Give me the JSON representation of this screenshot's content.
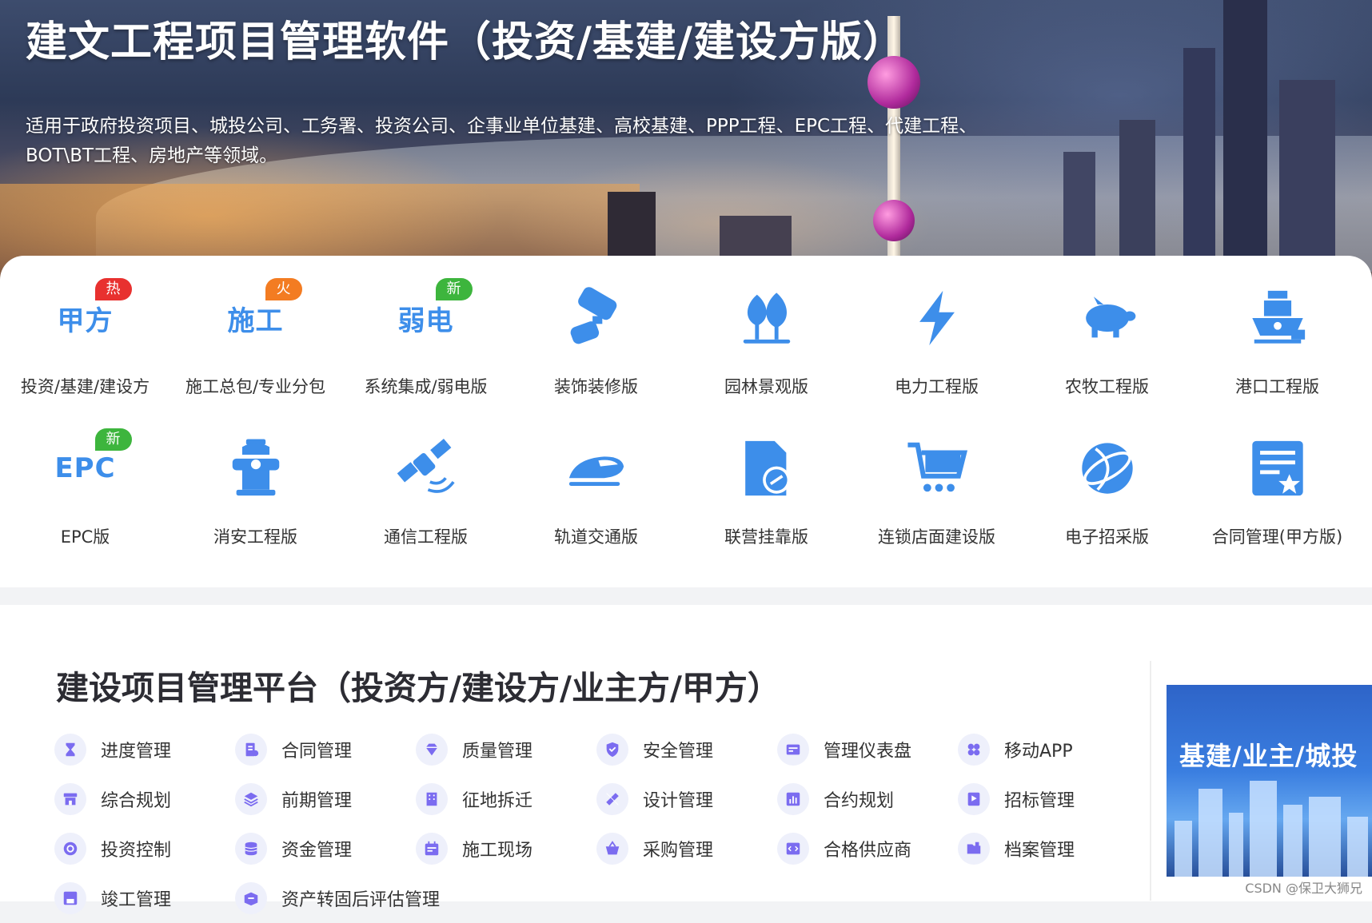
{
  "hero": {
    "title": "建文工程项目管理软件（投资/基建/建设方版）",
    "description": "适用于政府投资项目、城投公司、工务署、投资公司、企事业单位基建、高校基建、PPP工程、EPC工程、代建工程、BOT\\BT工程、房地产等领域。"
  },
  "versions": [
    {
      "word": "甲方",
      "tag": "热",
      "tag_color": "#e8312f",
      "label": "投资/基建/建设方",
      "icon": "text-icon"
    },
    {
      "word": "施工",
      "tag": "火",
      "tag_color": "#f37c22",
      "label": "施工总包/专业分包",
      "icon": "text-icon"
    },
    {
      "word": "弱电",
      "tag": "新",
      "tag_color": "#3db53d",
      "label": "系统集成/弱电版",
      "icon": "text-icon"
    },
    {
      "word": "",
      "tag": "",
      "label": "装饰装修版",
      "icon": "paint-roller-icon"
    },
    {
      "word": "",
      "tag": "",
      "label": "园林景观版",
      "icon": "tree-icon"
    },
    {
      "word": "",
      "tag": "",
      "label": "电力工程版",
      "icon": "lightning-icon"
    },
    {
      "word": "",
      "tag": "",
      "label": "农牧工程版",
      "icon": "pig-icon"
    },
    {
      "word": "",
      "tag": "",
      "label": "港口工程版",
      "icon": "ship-icon"
    },
    {
      "word": "EPC",
      "tag": "新",
      "tag_color": "#3db53d",
      "label": "EPC版",
      "icon": "text-icon"
    },
    {
      "word": "",
      "tag": "",
      "label": "消安工程版",
      "icon": "fire-hydrant-icon"
    },
    {
      "word": "",
      "tag": "",
      "label": "通信工程版",
      "icon": "satellite-icon"
    },
    {
      "word": "",
      "tag": "",
      "label": "轨道交通版",
      "icon": "train-icon"
    },
    {
      "word": "",
      "tag": "",
      "label": "联营挂靠版",
      "icon": "document-link-icon"
    },
    {
      "word": "",
      "tag": "",
      "label": "连锁店面建设版",
      "icon": "shopping-cart-icon"
    },
    {
      "word": "",
      "tag": "",
      "label": "电子招采版",
      "icon": "globe-icon"
    },
    {
      "word": "",
      "tag": "",
      "label": "合同管理(甲方版)",
      "icon": "contract-icon"
    }
  ],
  "platform": {
    "title": "建设项目管理平台（投资方/建设方/业主方/甲方）",
    "functions": [
      {
        "label": "进度管理",
        "icon": "hourglass-icon"
      },
      {
        "label": "合同管理",
        "icon": "contract-icon"
      },
      {
        "label": "质量管理",
        "icon": "diamond-icon"
      },
      {
        "label": "安全管理",
        "icon": "shield-icon"
      },
      {
        "label": "管理仪表盘",
        "icon": "dashboard-icon"
      },
      {
        "label": "移动APP",
        "icon": "app-icon"
      },
      {
        "label": "综合规划",
        "icon": "store-icon"
      },
      {
        "label": "前期管理",
        "icon": "layers-icon"
      },
      {
        "label": "征地拆迁",
        "icon": "building-icon"
      },
      {
        "label": "设计管理",
        "icon": "ruler-icon"
      },
      {
        "label": "合约规划",
        "icon": "bar-chart-icon"
      },
      {
        "label": "招标管理",
        "icon": "flag-icon"
      },
      {
        "label": "投资控制",
        "icon": "target-icon"
      },
      {
        "label": "资金管理",
        "icon": "coins-icon"
      },
      {
        "label": "施工现场",
        "icon": "calendar-icon"
      },
      {
        "label": "采购管理",
        "icon": "basket-icon"
      },
      {
        "label": "合格供应商",
        "icon": "code-icon"
      },
      {
        "label": "档案管理",
        "icon": "folder-icon"
      },
      {
        "label": "竣工管理",
        "icon": "save-icon"
      },
      {
        "label": "资产转固后评估管理",
        "icon": "box-icon"
      }
    ],
    "promo_text": "基建/业主/城投"
  },
  "watermark": "CSDN @保卫大狮兄",
  "colors": {
    "accent_blue": "#3d8eea",
    "func_icon_purple": "#7b6cf0",
    "func_icon_bg": "#eef0fb"
  }
}
